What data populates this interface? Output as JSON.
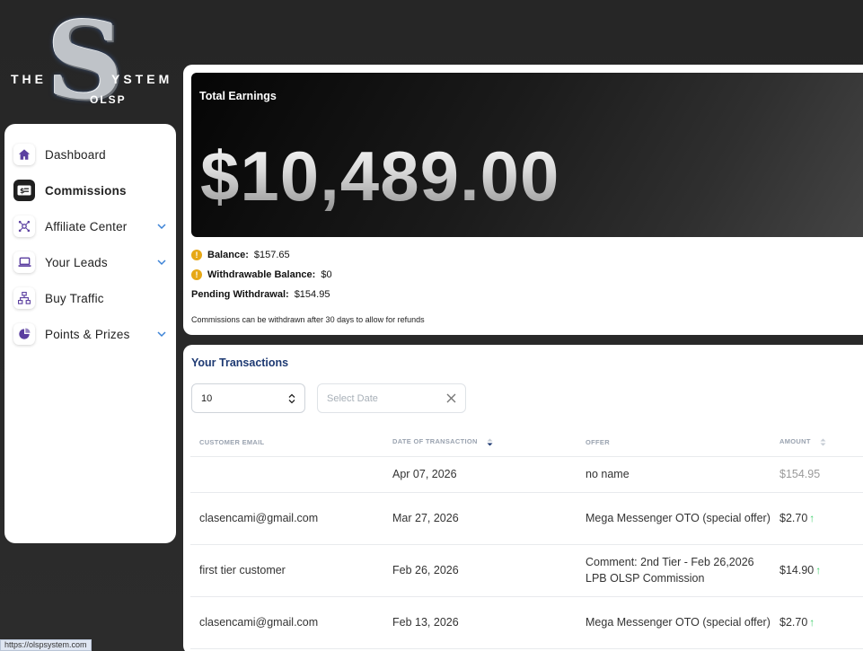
{
  "logo": {
    "mark": "S",
    "left": "THE",
    "right": "YSTEM",
    "sub": "OLSP"
  },
  "sidebar": {
    "items": [
      {
        "label": "Dashboard",
        "icon": "home-icon"
      },
      {
        "label": "Commissions",
        "icon": "money-icon",
        "active": true
      },
      {
        "label": "Affiliate Center",
        "icon": "network-icon",
        "expandable": true
      },
      {
        "label": "Your Leads",
        "icon": "laptop-icon",
        "expandable": true
      },
      {
        "label": "Buy Traffic",
        "icon": "sitemap-icon"
      },
      {
        "label": "Points & Prizes",
        "icon": "pie-icon",
        "expandable": true
      }
    ]
  },
  "earnings": {
    "title": "Total Earnings",
    "amount": "$10,489.00",
    "balance_label": "Balance:",
    "balance_value": "$157.65",
    "withdrawable_label": "Withdrawable Balance:",
    "withdrawable_value": "$0",
    "pending_label": "Pending Withdrawal:",
    "pending_value": "$154.95",
    "note": "Commissions can be withdrawn after 30 days to allow for refunds"
  },
  "transactions": {
    "title": "Your Transactions",
    "page_size": "10",
    "date_placeholder": "Select Date",
    "columns": [
      "CUSTOMER EMAIL",
      "DATE OF TRANSACTION",
      "OFFER",
      "AMOUNT"
    ],
    "rows": [
      {
        "email": "",
        "date": "Apr 07, 2026",
        "offer": "no name",
        "amount": "$154.95",
        "up": false
      },
      {
        "email": "clasencami@gmail.com",
        "date": "Mar 27, 2026",
        "offer": "Mega Messenger OTO (special offer)",
        "amount": "$2.70",
        "up": true
      },
      {
        "email": "first tier customer",
        "date": "Feb 26, 2026",
        "offer": "Comment: 2nd Tier - Feb 26,2026 LPB OLSP Commission",
        "amount": "$14.90",
        "up": true
      },
      {
        "email": "clasencami@gmail.com",
        "date": "Feb 13, 2026",
        "offer": "Mega Messenger OTO (special offer)",
        "amount": "$2.70",
        "up": true
      }
    ]
  },
  "status_bar": {
    "url": "https://olspsystem.com"
  },
  "colors": {
    "accent": "#1e3a73",
    "icon_purple": "#5b3fa0",
    "warning": "#e6a817",
    "up_arrow": "#3fcf6b"
  }
}
